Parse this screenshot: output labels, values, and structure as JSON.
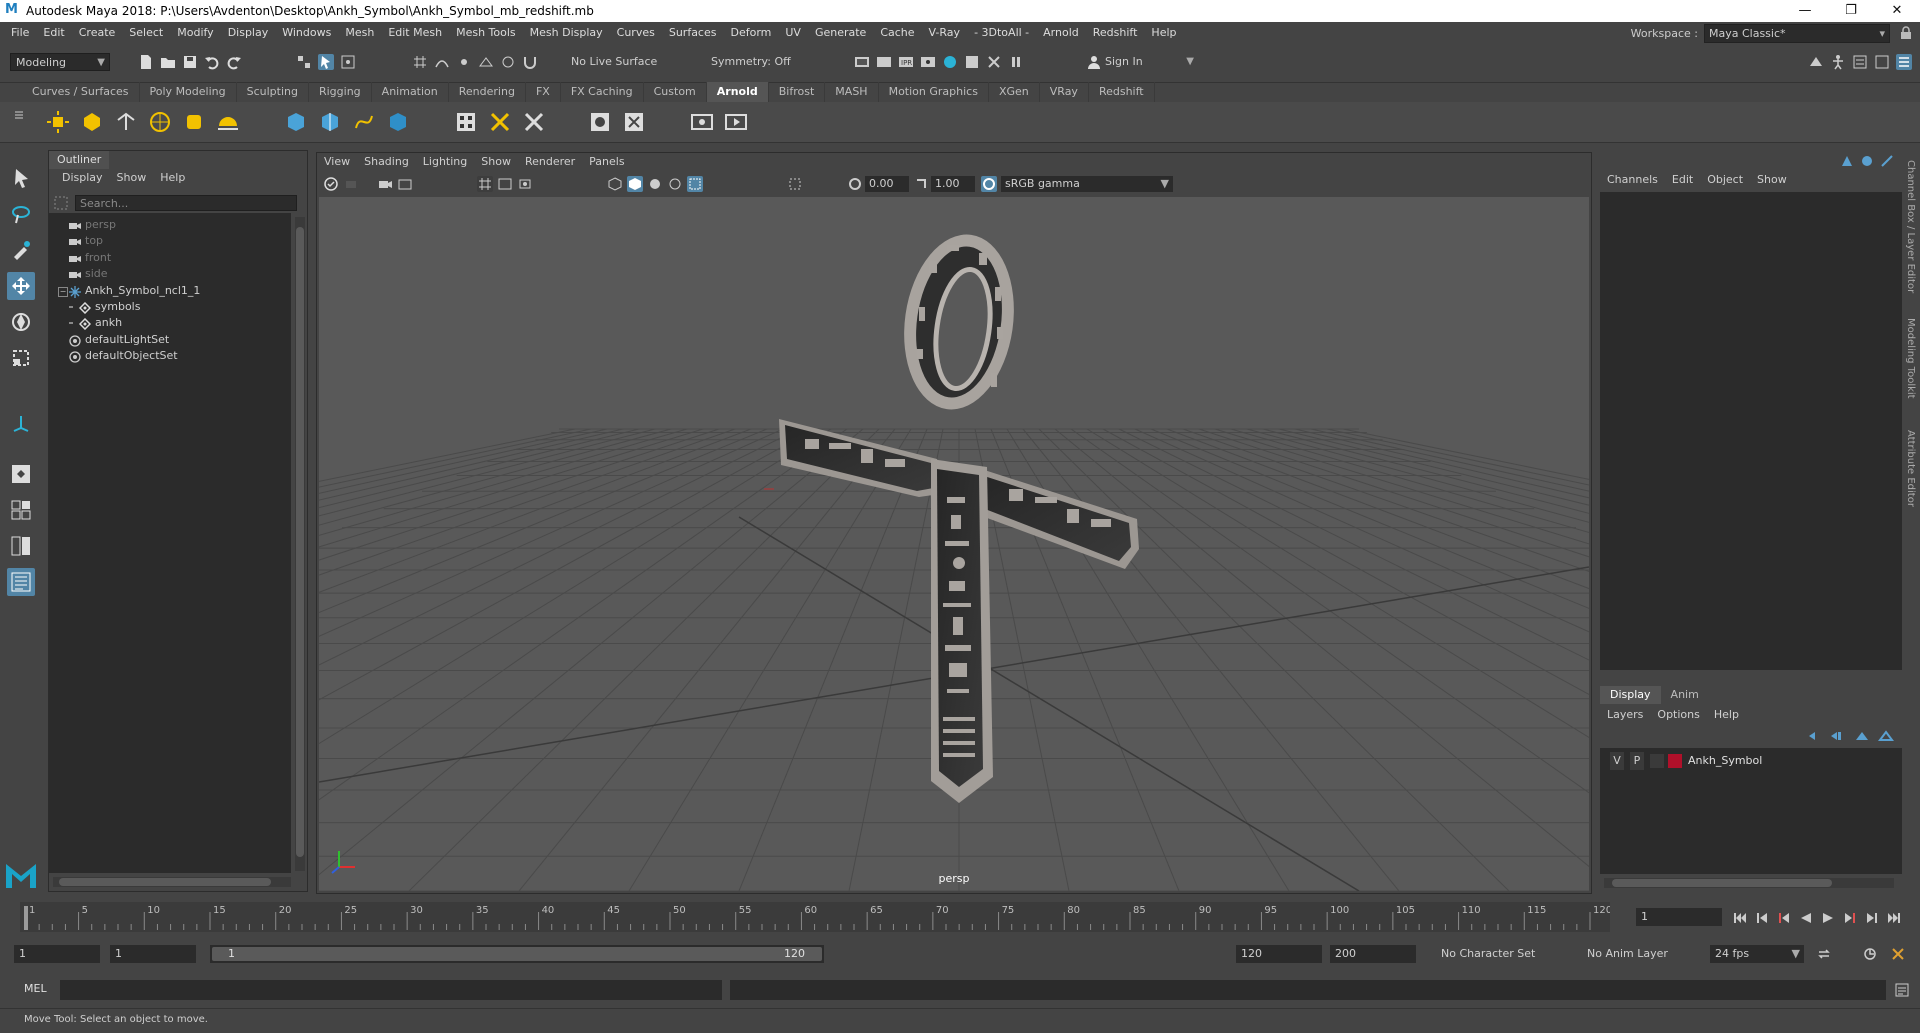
{
  "app": {
    "title": "Autodesk Maya 2018: P:\\Users\\Avdenton\\Desktop\\Ankh_Symbol\\Ankh_Symbol_mb_redshift.mb",
    "logo": "M",
    "window_buttons": [
      "—",
      "❐",
      "✕"
    ]
  },
  "menubar": [
    "File",
    "Edit",
    "Create",
    "Select",
    "Modify",
    "Display",
    "Windows",
    "Mesh",
    "Edit Mesh",
    "Mesh Tools",
    "Mesh Display",
    "Curves",
    "Surfaces",
    "Deform",
    "UV",
    "Generate",
    "Cache",
    "V-Ray",
    "- 3DtoAll -",
    "Arnold",
    "Redshift",
    "Help"
  ],
  "workspace": {
    "label": "Workspace :",
    "value": "Maya Classic*"
  },
  "statusline": {
    "mode": "Modeling",
    "live_surface": "No Live Surface",
    "symmetry": "Symmetry: Off",
    "sign_in": "Sign In"
  },
  "shelf": {
    "tabs": [
      "Curves / Surfaces",
      "Poly Modeling",
      "Sculpting",
      "Rigging",
      "Animation",
      "Rendering",
      "FX",
      "FX Caching",
      "Custom",
      "Arnold",
      "Bifrost",
      "MASH",
      "Motion Graphics",
      "XGen",
      "VRay",
      "Redshift"
    ],
    "active_tab": "Arnold"
  },
  "outliner": {
    "title": "Outliner",
    "menu": [
      "Display",
      "Show",
      "Help"
    ],
    "search_placeholder": "Search...",
    "items": [
      {
        "label": "persp",
        "dim": true,
        "indent": 1,
        "icon": "camera-icon"
      },
      {
        "label": "top",
        "dim": true,
        "indent": 1,
        "icon": "camera-icon"
      },
      {
        "label": "front",
        "dim": true,
        "indent": 1,
        "icon": "camera-icon"
      },
      {
        "label": "side",
        "dim": true,
        "indent": 1,
        "icon": "camera-icon"
      },
      {
        "label": "Ankh_Symbol_ncl1_1",
        "dim": false,
        "indent": 0,
        "icon": "group-icon",
        "expanded": true
      },
      {
        "label": "symbols",
        "dim": false,
        "indent": 2,
        "icon": "mesh-icon"
      },
      {
        "label": "ankh",
        "dim": false,
        "indent": 2,
        "icon": "mesh-icon"
      },
      {
        "label": "defaultLightSet",
        "dim": false,
        "indent": 1,
        "icon": "set-icon"
      },
      {
        "label": "defaultObjectSet",
        "dim": false,
        "indent": 1,
        "icon": "set-icon"
      }
    ]
  },
  "viewport": {
    "menu": [
      "View",
      "Shading",
      "Lighting",
      "Show",
      "Renderer",
      "Panels"
    ],
    "exposure": "0.00",
    "gamma": "1.00",
    "color_space": "sRGB gamma",
    "camera": "persp"
  },
  "channelbox": {
    "menu": [
      "Channels",
      "Edit",
      "Object",
      "Show"
    ]
  },
  "layers": {
    "tabs": [
      "Display",
      "Anim"
    ],
    "active_tab": "Display",
    "menu": [
      "Layers",
      "Options",
      "Help"
    ],
    "rows": [
      {
        "v": "V",
        "p": "P",
        "name": "Ankh_Symbol",
        "color": "#b0102a"
      }
    ]
  },
  "side_tabs": [
    "Channel Box / Layer Editor",
    "Modeling Toolkit",
    "Attribute Editor"
  ],
  "timeslider": {
    "start": 1,
    "end": 120,
    "current": 1,
    "labels": [
      "1",
      "5",
      "10",
      "15",
      "20",
      "25",
      "30",
      "35",
      "40",
      "45",
      "50",
      "55",
      "60",
      "65",
      "70",
      "75",
      "80",
      "85",
      "90",
      "95",
      "100",
      "105",
      "110",
      "115",
      "120"
    ],
    "current_frame_field": "1"
  },
  "range": {
    "start_field": "1",
    "playback_start": "1",
    "slider_start": "1",
    "slider_end": "120",
    "playback_end": "120",
    "end_field": "200",
    "character_set": "No Character Set",
    "anim_layer": "No Anim Layer",
    "fps": "24 fps"
  },
  "commandline": {
    "label": "MEL"
  },
  "helpline": "Move Tool: Select an object to move.",
  "colors": {
    "panel": "#444444",
    "field": "#2b2b2b",
    "accent": "#5285a6",
    "layer_color": "#b0102a"
  }
}
